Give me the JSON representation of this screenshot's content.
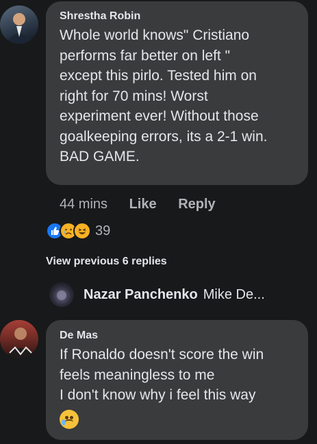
{
  "comments": [
    {
      "author": "Shrestha Robin",
      "text": "Whole world knows\" Cristiano\nperforms far better on left \"\nexcept this pirlo. Tested him on\nright for 70 mins! Worst\nexperiment ever! Without those\ngoalkeeping errors, its a 2-1 win.\nBAD GAME.",
      "time": "44 mins",
      "like_label": "Like",
      "reply_label": "Reply",
      "reaction_count": "39"
    },
    {
      "author": "De Mas",
      "text": "If Ronaldo doesn't score the win\nfeels meaningless to me\nI don't know why i feel this way"
    }
  ],
  "view_previous": "View previous 6 replies",
  "reply_preview": {
    "name": "Nazar Panchenko",
    "text": "Mike De..."
  },
  "colors": {
    "background": "#18191a",
    "bubble": "#3a3b3c",
    "like_blue": "#1877f2",
    "emoji_yellow": "#f7b125"
  },
  "icons": {
    "reactions": [
      "like-icon",
      "sad-icon",
      "haha-icon"
    ],
    "emoji": "crying-face-icon"
  }
}
